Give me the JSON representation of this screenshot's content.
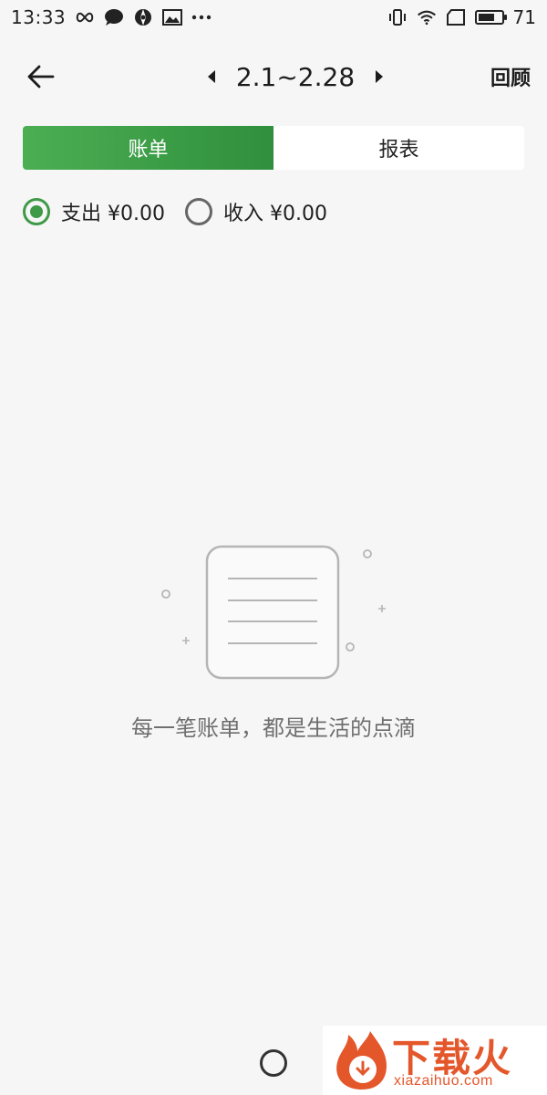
{
  "status_bar": {
    "time": "13:33",
    "icons_left": [
      "infinity-icon",
      "chat-bubble-icon",
      "aperture-icon",
      "image-icon",
      "more-dots-icon"
    ],
    "icons_right": [
      "vibrate-icon",
      "wifi-icon",
      "no-sim-icon",
      "battery-icon"
    ],
    "battery_percent": "71",
    "battery_level": 0.71
  },
  "header": {
    "period": "2.1~2.28",
    "review_label": "回顾"
  },
  "tabs": [
    {
      "label": "账单",
      "active": true
    },
    {
      "label": "报表",
      "active": false
    }
  ],
  "filters": [
    {
      "label": "支出 ¥0.00",
      "selected": true
    },
    {
      "label": "收入 ¥0.00",
      "selected": false
    }
  ],
  "empty_state": {
    "icon": "bill-document-icon",
    "message": "每一笔账单，都是生活的点滴"
  },
  "watermark": {
    "logo_text": "下载火",
    "site": "xiazaihuo.com"
  },
  "colors": {
    "accent_green": "#3f9a48",
    "watermark_orange": "#e4572b",
    "background": "#f6f6f6"
  }
}
